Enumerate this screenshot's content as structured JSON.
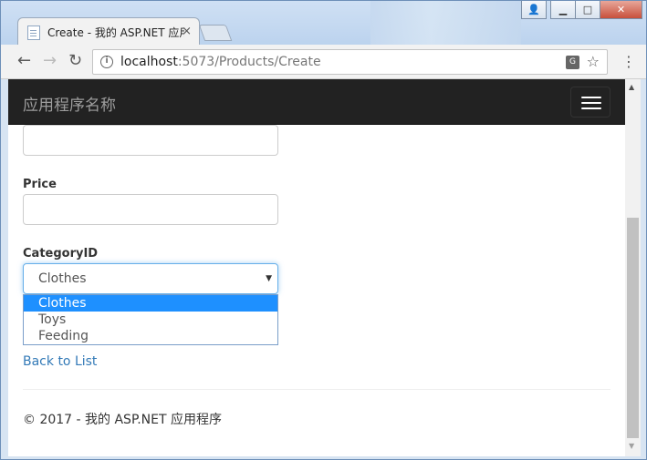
{
  "browser": {
    "tab_title": "Create - 我的 ASP.NET 应用程序",
    "tab_close": "×",
    "url_host": "localhost",
    "url_path": ":5073/Products/Create",
    "back_icon": "←",
    "forward_icon": "→",
    "reload_icon": "↻",
    "info_icon": "i",
    "translate_icon": "G",
    "star_icon": "☆",
    "menu_icon": "⋮",
    "win_user": "👤",
    "win_min": "▁",
    "win_max": "□",
    "win_close": "✕"
  },
  "navbar": {
    "brand": "应用程序名称"
  },
  "form": {
    "price_label": "Price",
    "category_label": "CategoryID",
    "category_selected": "Clothes",
    "category_arrow": "▼",
    "category_options": [
      "Clothes",
      "Toys",
      "Feeding"
    ],
    "selected_index": 0
  },
  "links": {
    "back_to_list": "Back to List"
  },
  "footer": {
    "text": "© 2017 - 我的 ASP.NET 应用程序"
  },
  "scrollbar": {
    "up": "▲",
    "down": "▼"
  }
}
